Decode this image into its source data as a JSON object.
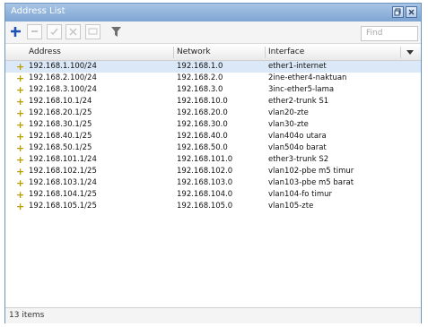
{
  "window": {
    "title": "Address List"
  },
  "toolbar": {
    "find_placeholder": "Find"
  },
  "columns": [
    "Address",
    "Network",
    "Interface"
  ],
  "rows": [
    {
      "address": "192.168.1.100/24",
      "network": "192.168.1.0",
      "interface": "ether1-internet"
    },
    {
      "address": "192.168.2.100/24",
      "network": "192.168.2.0",
      "interface": "2ine-ether4-naktuan"
    },
    {
      "address": "192.168.3.100/24",
      "network": "192.168.3.0",
      "interface": "3inc-ether5-lama"
    },
    {
      "address": "192.168.10.1/24",
      "network": "192.168.10.0",
      "interface": "ether2-trunk S1"
    },
    {
      "address": "192.168.20.1/25",
      "network": "192.168.20.0",
      "interface": "vlan20-zte"
    },
    {
      "address": "192.168.30.1/25",
      "network": "192.168.30.0",
      "interface": "vlan30-zte"
    },
    {
      "address": "192.168.40.1/25",
      "network": "192.168.40.0",
      "interface": "vlan404o utara"
    },
    {
      "address": "192.168.50.1/25",
      "network": "192.168.50.0",
      "interface": "vlan504o barat"
    },
    {
      "address": "192.168.101.1/24",
      "network": "192.168.101.0",
      "interface": "ether3-trunk S2"
    },
    {
      "address": "192.168.102.1/25",
      "network": "192.168.102.0",
      "interface": "vlan102-pbe m5 timur"
    },
    {
      "address": "192.168.103.1/24",
      "network": "192.168.103.0",
      "interface": "vlan103-pbe m5 barat"
    },
    {
      "address": "192.168.104.1/25",
      "network": "192.168.104.0",
      "interface": "vlan104-fo timur"
    },
    {
      "address": "192.168.105.1/25",
      "network": "192.168.105.0",
      "interface": "vlan105-zte"
    }
  ],
  "status": {
    "items_count": "13 items"
  }
}
